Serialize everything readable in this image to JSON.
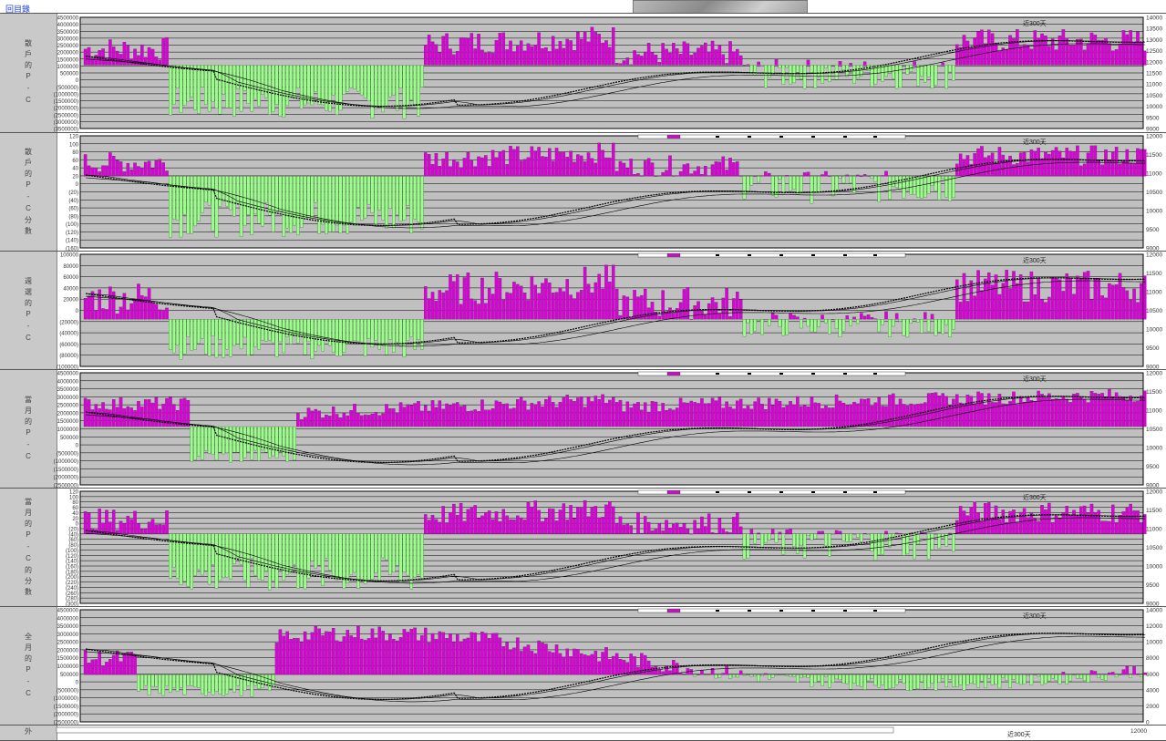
{
  "top_link": "回目錄",
  "panels": [
    {
      "id": "p1",
      "title": "散戶的P-C",
      "corner_label": "近300天",
      "left_ticks": [
        "4500000",
        "4000000",
        "3500000",
        "3000000",
        "2500000",
        "2000000",
        "1500000",
        "1000000",
        "500000",
        "0",
        "(500000)",
        "(1000000)",
        "(1500000)",
        "(2000000)",
        "(2500000)",
        "(3000000)",
        "(3500000)"
      ],
      "right_ticks": [
        "14000",
        "13500",
        "13000",
        "12500",
        "12000",
        "11500",
        "11000",
        "10500",
        "10000",
        "9500",
        "9000"
      ],
      "legend": [
        "",
        "",
        "",
        "",
        "",
        ""
      ]
    },
    {
      "id": "p2",
      "title": "散戶的P-C分數",
      "corner_label": "近300天",
      "left_ticks": [
        "120",
        "100",
        "80",
        "60",
        "40",
        "20",
        "0",
        "(20)",
        "(40)",
        "(60)",
        "(80)",
        "(100)",
        "(120)",
        "(140)",
        "(160)"
      ],
      "right_ticks": [
        "12000",
        "11500",
        "11000",
        "10500",
        "10000",
        "9500",
        "9000"
      ],
      "legend": [
        "",
        "",
        "",
        "",
        "",
        ""
      ]
    },
    {
      "id": "p3",
      "title": "週選的P-C",
      "corner_label": "近300天",
      "left_ticks": [
        "100000",
        "80000",
        "60000",
        "40000",
        "20000",
        "0",
        "(20000)",
        "(40000)",
        "(60000)",
        "(80000)",
        "(100000)"
      ],
      "right_ticks": [
        "12000",
        "11500",
        "11000",
        "10500",
        "10000",
        "9500",
        "9000"
      ],
      "legend": [
        "",
        "",
        "",
        "",
        "",
        ""
      ]
    },
    {
      "id": "p4",
      "title": "當月的P-C",
      "corner_label": "近300天",
      "left_ticks": [
        "4500000",
        "4000000",
        "3500000",
        "3000000",
        "2500000",
        "2000000",
        "1500000",
        "1000000",
        "500000",
        "0",
        "(500000)",
        "(1000000)",
        "(1500000)",
        "(2000000)",
        "(2500000)"
      ],
      "right_ticks": [
        "12000",
        "11500",
        "11000",
        "10500",
        "10000",
        "9500",
        "9000"
      ],
      "legend": [
        "",
        "",
        "",
        "",
        "",
        "",
        ""
      ]
    },
    {
      "id": "p5",
      "title": "當月的P-C的分數",
      "corner_label": "近300天",
      "left_ticks": [
        "120",
        "100",
        "80",
        "60",
        "40",
        "20",
        "0",
        "(20)",
        "(40)",
        "(60)",
        "(80)",
        "(100)",
        "(120)",
        "(140)",
        "(160)",
        "(180)",
        "(200)",
        "(220)",
        "(240)",
        "(260)",
        "(280)",
        "(300)"
      ],
      "right_ticks": [
        "12000",
        "11500",
        "11000",
        "10500",
        "10000",
        "9500",
        "9000"
      ],
      "legend": [
        "",
        "",
        "",
        "",
        "",
        ""
      ]
    },
    {
      "id": "p6",
      "title": "全月的P-C",
      "corner_label": "近300天",
      "left_ticks": [
        "4500000",
        "4000000",
        "3500000",
        "3000000",
        "2500000",
        "2000000",
        "1500000",
        "1000000",
        "500000",
        "0",
        "(500000)",
        "(1000000)",
        "(1500000)",
        "(2000000)",
        "(2500000)"
      ],
      "right_ticks": [
        "14000",
        "12000",
        "10000",
        "8000",
        "6000",
        "4000",
        "2000",
        "0"
      ],
      "legend": [
        "",
        "",
        "",
        "",
        "",
        ""
      ]
    }
  ],
  "bottom_panel": {
    "title": "外",
    "corner_label": "近300天",
    "right_tick": "12000",
    "legend": [
      "",
      "",
      "",
      "",
      "",
      ""
    ]
  },
  "colors": {
    "positive_bar": "#dd00dd",
    "negative_bar": "#99ff88",
    "plot_bg": "#c0c0c0",
    "grid": "#000000",
    "price_line": "#000000",
    "title_bg": "#c9c9c9"
  },
  "chart_data": [
    {
      "type": "bar",
      "panel": "p1",
      "note": "two y-axes: bars on left axis, index line on right axis",
      "series": [
        {
          "name": "",
          "values": []
        }
      ]
    },
    {
      "type": "bar",
      "panel": "p2",
      "series": [
        {
          "name": "",
          "values": []
        }
      ]
    },
    {
      "type": "bar",
      "panel": "p3",
      "series": [
        {
          "name": "",
          "values": []
        }
      ]
    },
    {
      "type": "bar",
      "panel": "p4",
      "series": [
        {
          "name": "",
          "values": []
        }
      ]
    },
    {
      "type": "bar",
      "panel": "p5",
      "series": [
        {
          "name": "",
          "values": []
        }
      ]
    },
    {
      "type": "bar",
      "panel": "p6",
      "series": [
        {
          "name": "",
          "values": []
        }
      ]
    }
  ]
}
